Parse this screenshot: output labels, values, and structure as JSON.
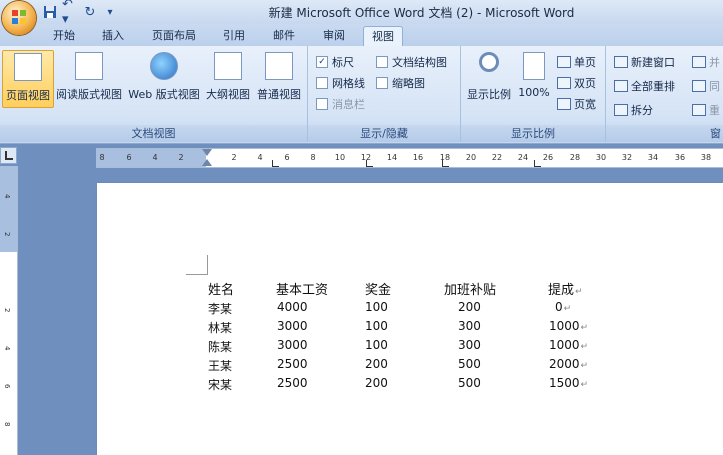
{
  "window": {
    "title": "新建 Microsoft Office Word 文档 (2) - Microsoft Word"
  },
  "quick_access": {
    "icons": [
      "save-icon",
      "undo-icon",
      "redo-icon",
      "customize-icon"
    ],
    "undo_label": "↶ ▾",
    "redo_label": "↻",
    "customize_label": "▾"
  },
  "tabs": [
    "开始",
    "插入",
    "页面布局",
    "引用",
    "邮件",
    "审阅",
    "视图"
  ],
  "active_tab": "视图",
  "ribbon": {
    "doc_views": {
      "label": "文档视图",
      "buttons": [
        "页面视图",
        "阅读版式视图",
        "Web 版式视图",
        "大纲视图",
        "普通视图"
      ]
    },
    "show_hide": {
      "label": "显示/隐藏",
      "ruler": "标尺",
      "gridlines": "网格线",
      "message_bar": "消息栏",
      "doc_map": "文档结构图",
      "thumbnails": "缩略图",
      "checked_mark": "✓"
    },
    "zoom": {
      "label": "显示比例",
      "zoom_btn": "显示比例",
      "percent": "100%",
      "one_page": "单页",
      "two_pages": "双页",
      "page_width": "页宽"
    },
    "window": {
      "label": "窗",
      "new_window": "新建窗口",
      "arrange_all": "全部重排",
      "split": "拆分",
      "side_by_side": "并",
      "sync": "同",
      "reset": "重"
    }
  },
  "ruler": {
    "h_ticks": [
      "8",
      "6",
      "4",
      "2",
      "2",
      "4",
      "6",
      "8",
      "10",
      "12",
      "14",
      "16",
      "18",
      "20",
      "22",
      "24",
      "26",
      "28",
      "30",
      "32",
      "34",
      "36",
      "38"
    ],
    "v_ticks": [
      "4",
      "2",
      "2",
      "4",
      "6",
      "8"
    ]
  },
  "document": {
    "headers": [
      "姓名",
      "基本工资",
      "奖金",
      "加班补贴",
      "提成"
    ],
    "rows": [
      [
        "李某",
        "4000",
        "100",
        "200",
        "0"
      ],
      [
        "林某",
        "3000",
        "100",
        "300",
        "1000"
      ],
      [
        "陈某",
        "3000",
        "100",
        "300",
        "1000"
      ],
      [
        "王某",
        "2500",
        "200",
        "500",
        "2000"
      ],
      [
        "宋某",
        "2500",
        "200",
        "500",
        "1500"
      ]
    ],
    "paragraph_mark": "↵"
  }
}
